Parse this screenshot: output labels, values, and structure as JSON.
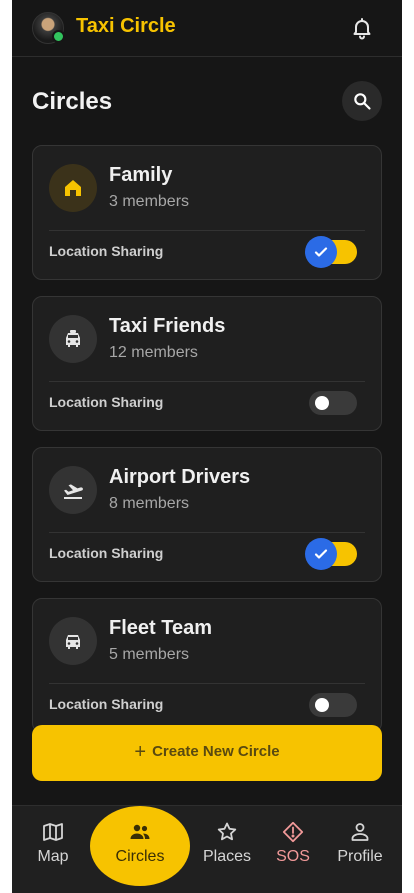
{
  "app": {
    "title": "Taxi Circle"
  },
  "page": {
    "title": "Circles"
  },
  "circles": [
    {
      "name": "Family",
      "members": "3 members",
      "icon": "home-icon",
      "sharing_label": "Location Sharing",
      "sharing_on": true
    },
    {
      "name": "Taxi Friends",
      "members": "12 members",
      "icon": "taxi-icon",
      "sharing_label": "Location Sharing",
      "sharing_on": false
    },
    {
      "name": "Airport Drivers",
      "members": "8 members",
      "icon": "plane-takeoff-icon",
      "sharing_label": "Location Sharing",
      "sharing_on": true
    },
    {
      "name": "Fleet Team",
      "members": "5 members",
      "icon": "car-icon",
      "sharing_label": "Location Sharing",
      "sharing_on": false
    }
  ],
  "create_button": {
    "label": "Create New Circle"
  },
  "bottom_nav": [
    {
      "label": "Map",
      "icon": "map-icon",
      "active": false
    },
    {
      "label": "Circles",
      "icon": "people-icon",
      "active": true
    },
    {
      "label": "Places",
      "icon": "star-icon",
      "active": false
    },
    {
      "label": "SOS",
      "icon": "warning-icon",
      "active": false
    },
    {
      "label": "Profile",
      "icon": "person-icon",
      "active": false
    }
  ],
  "colors": {
    "accent": "#f7c300",
    "background": "#161616",
    "card": "#1f1f1f",
    "toggle_check": "#2b6be6",
    "sos": "#f19999"
  }
}
